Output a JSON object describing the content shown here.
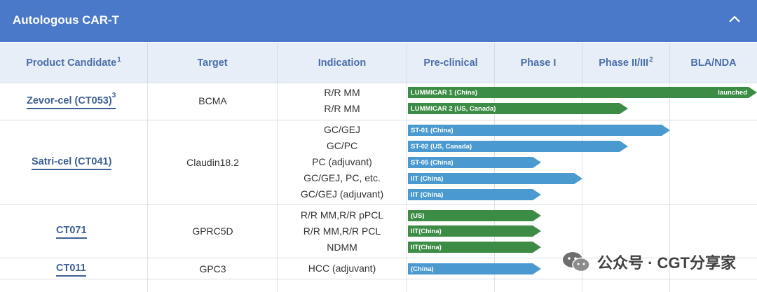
{
  "header": {
    "title": "Autologous CAR-T"
  },
  "columns": {
    "product": "Product Candidate",
    "product_sup": "1",
    "target": "Target",
    "indication": "Indication",
    "preclinical": "Pre-clinical",
    "phase1": "Phase I",
    "phase23": "Phase II/III",
    "phase23_sup": "2",
    "bla": "BLA/NDA"
  },
  "rows": [
    {
      "product": "Zevor-cel (CT053)",
      "product_sup": "3",
      "target": "BCMA",
      "indications": [
        "R/R MM",
        "R/R MM"
      ],
      "bars": [
        {
          "label": "LUMMICAR 1 (China)",
          "status": "launched",
          "color": "green"
        },
        {
          "label": "LUMMICAR 2 (US, Canada)",
          "color": "green"
        }
      ]
    },
    {
      "product": "Satri-cel (CT041)",
      "target": "Claudin18.2",
      "indications": [
        "GC/GEJ",
        "GC/PC",
        "PC (adjuvant)",
        "GC/GEJ, PC, etc.",
        "GC/GEJ (adjuvant)"
      ],
      "bars": [
        {
          "label": "ST-01 (China)",
          "color": "blue"
        },
        {
          "label": "ST-02 (US, Canada)",
          "color": "blue"
        },
        {
          "label": "ST-05 (China)",
          "color": "blue"
        },
        {
          "label": "IIT (China)",
          "color": "blue"
        },
        {
          "label": "IIT (China)",
          "color": "blue"
        }
      ]
    },
    {
      "product": "CT071",
      "target": "GPRC5D",
      "indications": [
        "R/R MM,R/R pPCL",
        "R/R MM,R/R PCL",
        "NDMM"
      ],
      "bars": [
        {
          "label": "(US)",
          "color": "green"
        },
        {
          "label": "IIT(China)",
          "color": "green"
        },
        {
          "label": "IIT(China)",
          "color": "green"
        }
      ]
    },
    {
      "product": "CT011",
      "target": "GPC3",
      "indications": [
        "HCC (adjuvant)"
      ],
      "bars": [
        {
          "label": "(China)",
          "color": "blue"
        }
      ]
    }
  ],
  "watermark": {
    "text": "公众号 · CGT分享家",
    "icon": "wechat-icon"
  }
}
